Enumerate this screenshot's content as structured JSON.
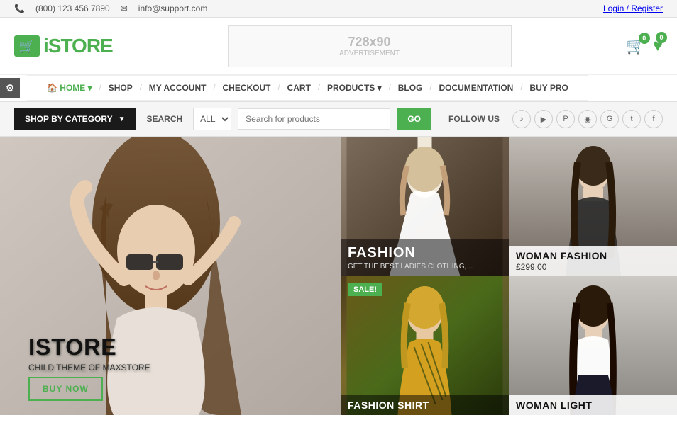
{
  "topbar": {
    "phone": "(800) 123 456 7890",
    "email": "info@support.com",
    "login_register": "Login / Register"
  },
  "header": {
    "logo_text_i": "i",
    "logo_text_rest": "STORE",
    "ad_label": "ADVERTISEMENT",
    "ad_size": "728x90",
    "cart_count": "0",
    "heart_count": "0"
  },
  "nav": {
    "items": [
      {
        "label": "HOME",
        "class": "home"
      },
      {
        "label": "SHOP"
      },
      {
        "label": "MY ACCOUNT"
      },
      {
        "label": "CHECKOUT"
      },
      {
        "label": "CART"
      },
      {
        "label": "PRODUCTS"
      },
      {
        "label": "BLOG"
      },
      {
        "label": "DOCUMENTATION"
      },
      {
        "label": "BUY PRO"
      }
    ]
  },
  "searchbar": {
    "shop_by_category": "SHOP BY CATEGORY",
    "search_label": "SEARCH",
    "select_default": "ALL",
    "input_placeholder": "Search for products",
    "go_button": "GO",
    "follow_us": "FOLLOW US",
    "social": [
      "music-icon",
      "video-icon",
      "pin-icon",
      "instagram-icon",
      "google-icon",
      "twitter-icon",
      "facebook-icon"
    ]
  },
  "hero": {
    "title": "ISTORE",
    "subtitle": "CHILD THEME OF MAXSTORE",
    "buy_now": "BUY NOW"
  },
  "grid": {
    "items": [
      {
        "id": "fashion",
        "title": "FASHION",
        "subtitle": "GET THE BEST LADIES CLOTHING, ...",
        "sale": false,
        "style": "dark-overlay",
        "price": null
      },
      {
        "id": "woman-fashion",
        "title": "WOMAN FASHION",
        "subtitle": null,
        "sale": false,
        "style": "light-overlay",
        "price": "£299.00"
      },
      {
        "id": "fashion-shirt",
        "title": "FASHION SHIRT",
        "subtitle": null,
        "sale": true,
        "style": "dark-overlay",
        "price": null
      },
      {
        "id": "woman-light",
        "title": "WOMAN LIGHT",
        "subtitle": null,
        "sale": false,
        "style": "light-overlay",
        "price": null
      }
    ]
  },
  "colors": {
    "green": "#4caf50",
    "dark": "#1a1a1a"
  }
}
